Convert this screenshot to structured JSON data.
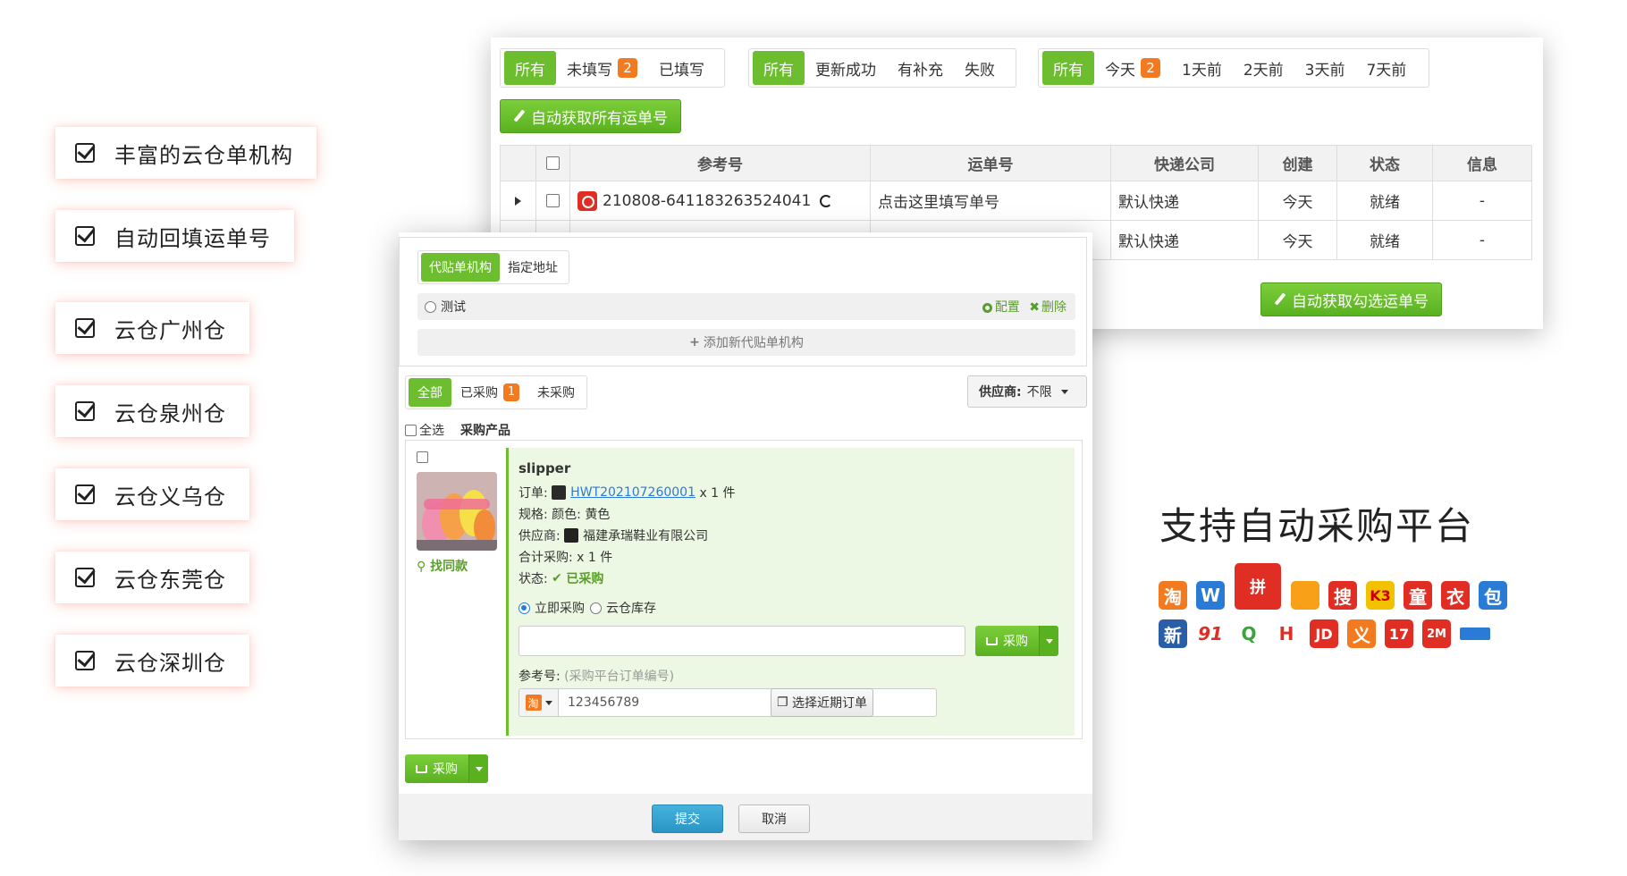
{
  "features": [
    "丰富的云仓单机构",
    "自动回填运单号",
    "云仓广州仓",
    "云仓泉州仓",
    "云仓义乌仓",
    "云仓东莞仓",
    "云仓深圳仓"
  ],
  "top_panel": {
    "filter_fill": {
      "all": "所有",
      "unfilled": "未填写",
      "unfilled_count": "2",
      "filled": "已填写"
    },
    "filter_update": {
      "all": "所有",
      "success": "更新成功",
      "supplement": "有补充",
      "failed": "失败"
    },
    "filter_date": {
      "all": "所有",
      "today": "今天",
      "today_count": "2",
      "d1": "1天前",
      "d2": "2天前",
      "d3": "3天前",
      "d7": "7天前"
    },
    "auto_fetch_all_label": "自动获取所有运单号",
    "auto_fetch_selected_label": "自动获取勾选运单号",
    "columns": [
      "参考号",
      "运单号",
      "快递公司",
      "创建",
      "状态",
      "信息"
    ],
    "rows": [
      {
        "ref": "210808-641183263524041",
        "waybill_placeholder": "点击这里填写单号",
        "courier": "默认快递",
        "created": "今天",
        "status": "就绪",
        "info": "-"
      },
      {
        "ref": "",
        "waybill_placeholder": "",
        "courier": "默认快递",
        "created": "今天",
        "status": "就绪",
        "info": "-"
      }
    ]
  },
  "front_panel": {
    "tab_agency": "代贴单机构",
    "tab_address": "指定地址",
    "agency_option": "测试",
    "config_label": "配置",
    "delete_label": "删除",
    "add_agency_label": "添加新代贴单机构",
    "purchase_tabs": {
      "all": "全部",
      "purchased": "已采购",
      "purchased_count": "1",
      "unpurchased": "未采购"
    },
    "supplier_label": "供应商:",
    "supplier_value": "不限",
    "select_all_label": "全选",
    "product_header": "采购产品",
    "find_same_label": "找同款",
    "product": {
      "name": "slipper",
      "order_label": "订单:",
      "order_no": "HWT202107260001",
      "order_qty": "x 1 件",
      "spec_label": "规格:",
      "spec_value": "颜色: 黄色",
      "supplier_label": "供应商:",
      "supplier_value": "福建承瑞鞋业有限公司",
      "total_label": "合计采购:",
      "total_value": "x 1 件",
      "status_label": "状态:",
      "status_value": "已采购",
      "opt_now": "立即采购",
      "opt_stock": "云仓库存",
      "purchase_btn": "采购",
      "ref_label": "参考号:",
      "ref_hint": "(采购平台订单编号)",
      "ref_platform_icon": "淘",
      "ref_value": "123456789",
      "recent_orders_btn": "选择近期订单"
    },
    "bottom_purchase_btn": "采购",
    "submit_label": "提交",
    "cancel_label": "取消"
  },
  "platforms": {
    "title": "支持自动采购平台",
    "row1": [
      "淘",
      "W",
      "拼",
      "",
      "搜",
      "K3",
      "童",
      "衣",
      "包"
    ],
    "row2": [
      "新",
      "91",
      "Q",
      "H",
      "JD",
      "义",
      "17",
      "2M",
      ""
    ]
  },
  "colors": {
    "accent_green": "#6cbe2e",
    "badge_orange": "#f47a20",
    "link_blue": "#2b7bd6",
    "submit_blue": "#2a95c5"
  }
}
